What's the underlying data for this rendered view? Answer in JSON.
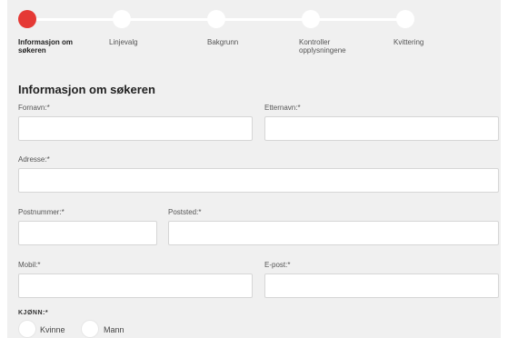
{
  "stepper": {
    "steps": [
      {
        "label": "Informasjon om\nsøkeren",
        "active": true
      },
      {
        "label": "Linjevalg",
        "active": false
      },
      {
        "label": "Bakgrunn",
        "active": false
      },
      {
        "label": "Kontroller\nopplysningene",
        "active": false
      },
      {
        "label": "Kvittering",
        "active": false
      }
    ],
    "active_color": "#e53935"
  },
  "form": {
    "title": "Informasjon om søkeren",
    "fornavn": {
      "label": "Fornavn:*",
      "value": ""
    },
    "etternavn": {
      "label": "Etternavn:*",
      "value": ""
    },
    "adresse": {
      "label": "Adresse:*",
      "value": ""
    },
    "postnummer": {
      "label": "Postnummer:*",
      "value": ""
    },
    "poststed": {
      "label": "Poststed:*",
      "value": ""
    },
    "mobil": {
      "label": "Mobil:*",
      "value": ""
    },
    "epost": {
      "label": "E-post:*",
      "value": ""
    },
    "kjonn": {
      "label": "KJØNN:*",
      "options": [
        {
          "label": "Kvinne"
        },
        {
          "label": "Mann"
        }
      ]
    }
  }
}
